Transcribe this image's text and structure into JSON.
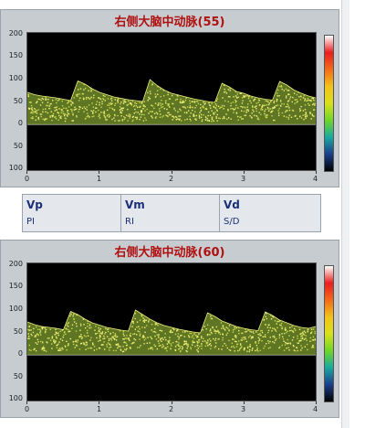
{
  "panels": [
    {
      "title": "右侧大脑中动脉(55)",
      "y_ticks": [
        "200",
        "150",
        "100",
        "50",
        "0",
        "50",
        "100"
      ],
      "x_ticks": [
        "0",
        "1",
        "2",
        "3",
        "4"
      ]
    },
    {
      "title": "右侧大脑中动脉(60)",
      "y_ticks": [
        "200",
        "150",
        "100",
        "50",
        "0",
        "50",
        "100"
      ],
      "x_ticks": [
        "0",
        "1",
        "2",
        "3",
        "4"
      ]
    }
  ],
  "params": {
    "vp": "Vp",
    "pi": "PI",
    "vm": "Vm",
    "ri": "RI",
    "vd": "Vd",
    "sd": "S/D"
  },
  "colors": {
    "title": "#b01010",
    "panel_bg": "#c7ccd0",
    "plot_bg": "#000000",
    "spectrum_low": "#6f8a2a",
    "spectrum_high": "#f2ef7a",
    "param_text": "#1a2f7a"
  },
  "colorbar_stops": [
    "#ffffff",
    "#e81e1e",
    "#f46a1a",
    "#f2c21a",
    "#d8e01c",
    "#6fd52a",
    "#1aa8a0",
    "#1a3f8a",
    "#000000"
  ],
  "chart_data": [
    {
      "type": "area",
      "title": "右侧大脑中动脉(55)",
      "xlabel": "",
      "ylabel": "",
      "xlim": [
        0,
        4
      ],
      "ylim": [
        -100,
        200
      ],
      "x_ticks": [
        0,
        1,
        2,
        3,
        4
      ],
      "y_ticks": [
        200,
        150,
        100,
        50,
        0,
        -50,
        -100
      ],
      "series": [
        {
          "x": [
            0,
            0.1,
            0.2,
            0.3,
            0.4,
            0.5,
            0.6,
            0.7,
            0.8,
            0.9,
            1.0,
            1.1,
            1.2,
            1.3,
            1.4,
            1.5,
            1.6,
            1.7,
            1.8,
            1.9,
            2.0,
            2.1,
            2.2,
            2.3,
            2.4,
            2.5,
            2.6,
            2.7,
            2.8,
            2.9,
            3.0,
            3.1,
            3.2,
            3.3,
            3.4,
            3.5,
            3.6,
            3.7,
            3.8,
            3.9,
            4.0
          ],
          "y": [
            70,
            65,
            62,
            60,
            58,
            55,
            52,
            95,
            88,
            78,
            70,
            65,
            60,
            57,
            54,
            52,
            50,
            98,
            85,
            75,
            68,
            64,
            60,
            56,
            53,
            50,
            48,
            90,
            82,
            72,
            68,
            62,
            58,
            55,
            53,
            94,
            86,
            75,
            68,
            62,
            58
          ]
        }
      ]
    },
    {
      "type": "area",
      "title": "右侧大脑中动脉(60)",
      "xlabel": "",
      "ylabel": "",
      "xlim": [
        0,
        4
      ],
      "ylim": [
        -100,
        200
      ],
      "x_ticks": [
        0,
        1,
        2,
        3,
        4
      ],
      "y_ticks": [
        200,
        150,
        100,
        50,
        0,
        -50,
        -100
      ],
      "series": [
        {
          "x": [
            0,
            0.1,
            0.2,
            0.3,
            0.4,
            0.5,
            0.6,
            0.7,
            0.8,
            0.9,
            1.0,
            1.1,
            1.2,
            1.3,
            1.4,
            1.5,
            1.6,
            1.7,
            1.8,
            1.9,
            2.0,
            2.1,
            2.2,
            2.3,
            2.4,
            2.5,
            2.6,
            2.7,
            2.8,
            2.9,
            3.0,
            3.1,
            3.2,
            3.3,
            3.4,
            3.5,
            3.6,
            3.7,
            3.8,
            3.9,
            4.0
          ],
          "y": [
            72,
            66,
            62,
            60,
            58,
            55,
            95,
            88,
            78,
            70,
            65,
            60,
            57,
            54,
            52,
            98,
            88,
            78,
            70,
            64,
            60,
            56,
            53,
            50,
            48,
            92,
            84,
            74,
            68,
            62,
            58,
            55,
            53,
            94,
            86,
            76,
            70,
            64,
            60,
            58,
            62
          ]
        }
      ]
    }
  ]
}
